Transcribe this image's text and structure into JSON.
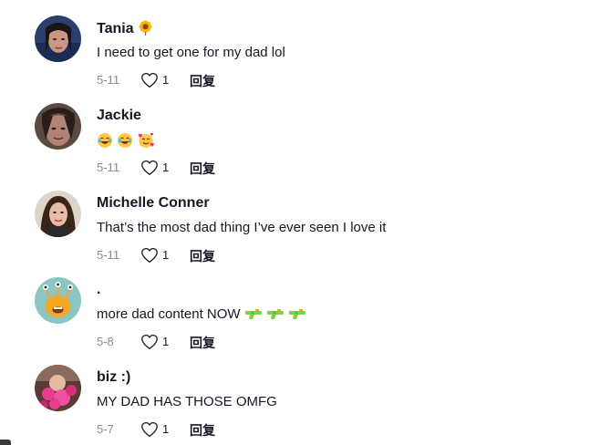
{
  "reply_label": "回复",
  "comments": [
    {
      "username": "Tania",
      "username_emoji": "sunflower-emoji",
      "text": "I need to get one for my dad lol",
      "date": "5-11",
      "likes": "1"
    },
    {
      "username": "Jackie",
      "text_emojis": [
        "joy-emoji",
        "joy-emoji",
        "smiling-face-with-hearts-emoji"
      ],
      "date": "5-11",
      "likes": "1"
    },
    {
      "username": "Michelle Conner",
      "text": "That’s the most dad thing I’ve ever seen I love it",
      "date": "5-11",
      "likes": "1"
    },
    {
      "username": ".",
      "text": "more dad content NOW",
      "text_emojis": [
        "water-pistol-emoji",
        "water-pistol-emoji",
        "water-pistol-emoji"
      ],
      "date": "5-8",
      "likes": "1"
    },
    {
      "username": "biz :)",
      "text": "MY DAD HAS THOSE OMFG",
      "date": "5-7",
      "likes": "1"
    }
  ],
  "colors": {
    "text_primary": "#161823",
    "text_secondary": "#8a8b91",
    "avatar_teal": "#8cc6c2"
  }
}
